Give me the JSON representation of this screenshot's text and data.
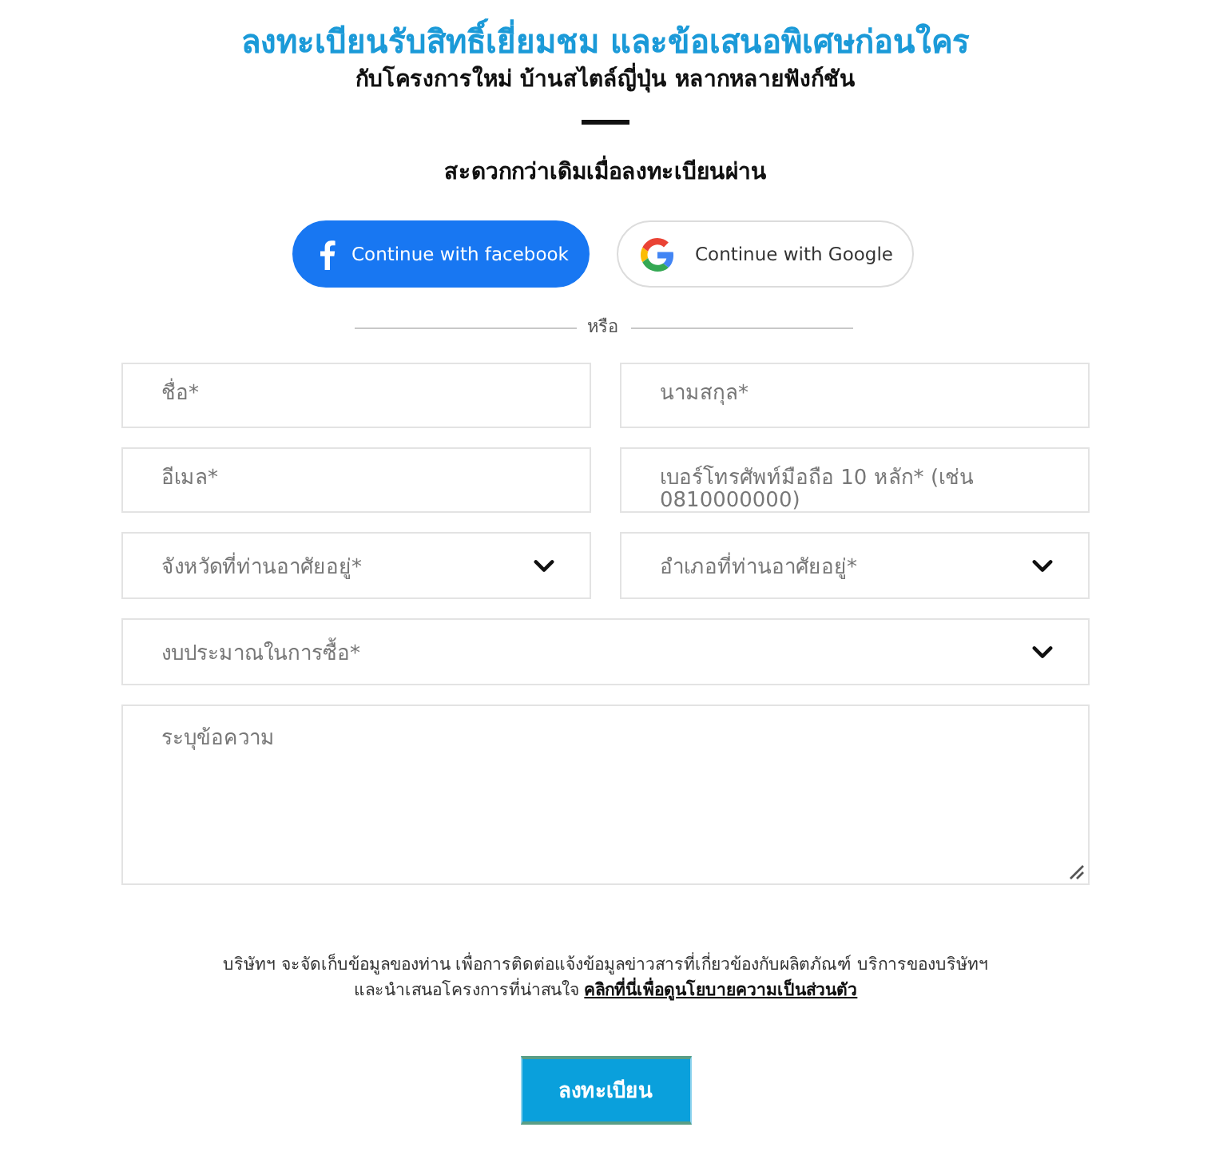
{
  "header": {
    "title": "ลงทะเบียนรับสิทธิ์เยี่ยมชม และข้อเสนอพิเศษก่อนใคร",
    "subtitle": "กับโครงการใหม่ บ้านสไตล์ญี่ปุ่น หลากหลายฟังก์ชัน",
    "prompt": "สะดวกกว่าเดิมเมื่อลงทะเบียนผ่าน"
  },
  "social_buttons": [
    {
      "kind": "facebook",
      "label": "Continue with facebook"
    },
    {
      "kind": "google",
      "label": "Continue with Google"
    }
  ],
  "divider": {
    "label": "หรือ"
  },
  "form": {
    "rows": [
      [
        {
          "kind": "text",
          "placeholder": "ชื่อ*"
        },
        {
          "kind": "text",
          "placeholder": "นามสกุล*"
        }
      ],
      [
        {
          "kind": "text",
          "placeholder": "อีเมล*"
        },
        {
          "kind": "text",
          "placeholder": "เบอร์โทรศัพท์มือถือ 10 หลัก* (เช่น 0810000000)"
        }
      ],
      [
        {
          "kind": "select",
          "placeholder": "จังหวัดที่ท่านอาศัยอยู่*"
        },
        {
          "kind": "select",
          "placeholder": "อำเภอที่ท่านอาศัยอยู่*"
        }
      ],
      [
        {
          "kind": "select",
          "placeholder": "งบประมาณในการซื้อ*"
        }
      ],
      [
        {
          "kind": "textarea",
          "placeholder": "ระบุข้อความ"
        }
      ]
    ]
  },
  "consent": {
    "text": "บริษัทฯ จะจัดเก็บข้อมูลของท่าน เพื่อการติดต่อแจ้งข้อมูลข่าวสารที่เกี่ยวข้องกับผลิตภัณฑ์ บริการของบริษัทฯ และนำเสนอโครงการที่น่าสนใจ",
    "link": "คลิกที่นี่เพื่อดูนโยบายความเป็นส่วนตัว"
  },
  "submit": {
    "label": "ลงทะเบียน"
  }
}
